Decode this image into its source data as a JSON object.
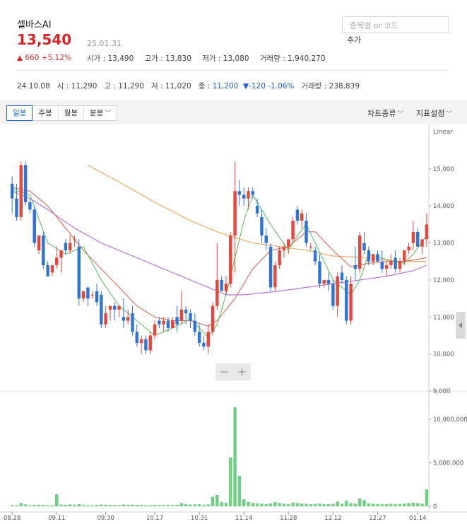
{
  "header": {
    "stock_name": "셀바스AI",
    "price": "13,540",
    "date": "25.01.31",
    "change": "▲ 660 +5.12%",
    "stats": {
      "open": "시가 : 13,490",
      "high": "고가 : 13,830",
      "low": "저가 : 13,080",
      "volume": "거래량 : 1,940,270"
    },
    "search_placeholder": "종목명 or 코드",
    "add_label": "추가"
  },
  "ohlc_line": {
    "date": "24.10.08",
    "open": "시 : 11,290",
    "high": "고 : 11,290",
    "low": "저 : 11,020",
    "close_label": "종 : ",
    "close": "11,200",
    "change": "▼-120 -1.06%",
    "volume": "거래량 : 238,839"
  },
  "toolbar": {
    "periods": [
      "일봉",
      "주봉",
      "월봉",
      "분봉"
    ],
    "active_period": "일봉",
    "chart_type": "차트종류",
    "indicator_settings": "지표설정"
  },
  "colors": {
    "up": "#e8453c",
    "down": "#2f73d8",
    "volume": "#6fcf84",
    "price_red": "#d7262a",
    "ma5": "#62c162",
    "ma20": "#d9695a",
    "ma60": "#b26ad8",
    "ma120": "#f0a358"
  },
  "chart_data": {
    "type": "candlestick",
    "scale": "Linear",
    "x_tick_labels": [
      "08.28",
      "09.11",
      "09.30",
      "10.17",
      "10.31",
      "11.14",
      "11.28",
      "12.12",
      "12.27",
      "01.14"
    ],
    "price_axis": {
      "ticks": [
        9000,
        10000,
        11000,
        12000,
        13000,
        14000,
        15000
      ],
      "labels": [
        "9,000",
        "10,000",
        "11,000",
        "12,000",
        "13,000",
        "14,000",
        "15,000"
      ]
    },
    "volume_axis": {
      "ticks": [
        0,
        5000000,
        10000000
      ],
      "labels": [
        "0",
        "5,000,000",
        "10,000,000"
      ]
    },
    "candles": [
      [
        14600,
        14800,
        13800,
        14200,
        150000
      ],
      [
        14200,
        14600,
        13600,
        13700,
        140000
      ],
      [
        13700,
        15200,
        13600,
        15100,
        380000
      ],
      [
        15100,
        15200,
        14000,
        14100,
        220000
      ],
      [
        14100,
        14200,
        13800,
        13900,
        120000
      ],
      [
        13900,
        14000,
        12900,
        13000,
        160000
      ],
      [
        12800,
        13200,
        12700,
        13200,
        180000
      ],
      [
        13200,
        13300,
        12300,
        12400,
        150000
      ],
      [
        12400,
        12500,
        12100,
        12100,
        120000
      ],
      [
        12200,
        12400,
        12100,
        12400,
        130000
      ],
      [
        12400,
        12900,
        12300,
        12600,
        1400000
      ],
      [
        12600,
        12800,
        12200,
        12800,
        200000
      ],
      [
        13000,
        13100,
        12700,
        12800,
        160000
      ],
      [
        12800,
        13200,
        12700,
        13000,
        220000
      ],
      [
        13100,
        13200,
        12900,
        13100,
        180000
      ],
      [
        12900,
        13100,
        11300,
        11500,
        260000
      ],
      [
        11500,
        11700,
        11400,
        11700,
        140000
      ],
      [
        11800,
        11800,
        11300,
        11500,
        120000
      ],
      [
        11600,
        11700,
        11500,
        11600,
        110000
      ],
      [
        11700,
        11900,
        11300,
        11400,
        160000
      ],
      [
        11600,
        11700,
        10700,
        10800,
        200000
      ],
      [
        10800,
        11300,
        10700,
        11100,
        180000
      ],
      [
        11200,
        11300,
        10900,
        11300,
        150000
      ],
      [
        11300,
        11400,
        10900,
        11200,
        140000
      ],
      [
        11200,
        11300,
        11000,
        11300,
        120000
      ],
      [
        11000,
        11500,
        10700,
        10900,
        210000
      ],
      [
        10900,
        11200,
        10800,
        11000,
        170000
      ],
      [
        11100,
        11300,
        10500,
        10600,
        190000
      ],
      [
        10600,
        10800,
        10200,
        10300,
        160000
      ],
      [
        10300,
        10500,
        10000,
        10400,
        140000
      ],
      [
        10400,
        10500,
        10000,
        10100,
        130000
      ],
      [
        10100,
        10600,
        10000,
        10500,
        120000
      ],
      [
        10500,
        10900,
        10400,
        10800,
        150000
      ],
      [
        10900,
        11000,
        10700,
        10800,
        140000
      ],
      [
        10800,
        11000,
        10600,
        10900,
        130000
      ],
      [
        10900,
        11000,
        10600,
        10700,
        160000
      ],
      [
        10700,
        11000,
        10700,
        10900,
        140000
      ],
      [
        11000,
        11300,
        10600,
        10800,
        180000
      ],
      [
        10900,
        11700,
        10800,
        11200,
        380000
      ],
      [
        11200,
        11300,
        10800,
        11100,
        260000
      ],
      [
        11100,
        11200,
        10700,
        10900,
        200000
      ],
      [
        10900,
        11100,
        10500,
        10600,
        220000
      ],
      [
        10600,
        10800,
        10200,
        10300,
        240000
      ],
      [
        10300,
        10500,
        10100,
        10200,
        180000
      ],
      [
        10200,
        10800,
        10000,
        10600,
        210000
      ],
      [
        10600,
        11400,
        10500,
        11300,
        1100000
      ],
      [
        11300,
        13000,
        11200,
        12000,
        1300000
      ],
      [
        12000,
        12100,
        11700,
        11700,
        500000
      ],
      [
        11700,
        12100,
        11600,
        11900,
        400000
      ],
      [
        11900,
        13300,
        11800,
        13200,
        5600000
      ],
      [
        13200,
        15200,
        12200,
        14400,
        11400000
      ],
      [
        14400,
        14700,
        14000,
        14300,
        3500000
      ],
      [
        14300,
        14500,
        14000,
        14200,
        800000
      ],
      [
        14200,
        14500,
        13900,
        14400,
        500000
      ],
      [
        14400,
        14500,
        14200,
        14300,
        400000
      ],
      [
        14000,
        14200,
        13700,
        13800,
        350000
      ],
      [
        13700,
        13900,
        13000,
        13200,
        300000
      ],
      [
        13200,
        13400,
        12800,
        13000,
        260000
      ],
      [
        12900,
        13000,
        11700,
        11800,
        320000
      ],
      [
        11800,
        12500,
        11700,
        12400,
        500000
      ],
      [
        12400,
        12900,
        12300,
        12800,
        380000
      ],
      [
        12800,
        13000,
        12600,
        12900,
        300000
      ],
      [
        12900,
        13100,
        12700,
        13100,
        250000
      ],
      [
        13100,
        13700,
        13000,
        13600,
        420000
      ],
      [
        13900,
        14000,
        13500,
        13600,
        380000
      ],
      [
        13600,
        13900,
        13400,
        13800,
        330000
      ],
      [
        13600,
        13800,
        12900,
        13000,
        300000
      ],
      [
        12900,
        13000,
        12800,
        12900,
        250000
      ],
      [
        12800,
        12900,
        12400,
        12500,
        280000
      ],
      [
        12500,
        12700,
        11800,
        11900,
        330000
      ],
      [
        11900,
        12000,
        11800,
        12000,
        260000
      ],
      [
        12000,
        12200,
        11700,
        11900,
        240000
      ],
      [
        11900,
        12000,
        11200,
        11300,
        300000
      ],
      [
        11300,
        12200,
        11000,
        12100,
        550000
      ],
      [
        12200,
        12400,
        11900,
        12000,
        300000
      ],
      [
        12000,
        12100,
        10800,
        10900,
        640000
      ],
      [
        10900,
        12100,
        10800,
        11900,
        380000
      ],
      [
        12400,
        12900,
        12000,
        12300,
        300000
      ],
      [
        12300,
        13300,
        12200,
        13200,
        900000
      ],
      [
        13000,
        13300,
        12700,
        12800,
        700000
      ],
      [
        12800,
        12900,
        12400,
        12500,
        350000
      ],
      [
        12500,
        12700,
        12400,
        12700,
        300000
      ],
      [
        12700,
        12800,
        12500,
        12500,
        280000
      ],
      [
        12500,
        12800,
        12200,
        12300,
        260000
      ],
      [
        12300,
        12500,
        12100,
        12400,
        250000
      ],
      [
        12400,
        12700,
        12300,
        12500,
        300000
      ],
      [
        12600,
        12800,
        12200,
        12300,
        280000
      ],
      [
        12300,
        12600,
        12200,
        12500,
        260000
      ],
      [
        12500,
        12800,
        12400,
        12800,
        320000
      ],
      [
        12800,
        13000,
        12700,
        12900,
        380000
      ],
      [
        13000,
        13600,
        12800,
        13300,
        420000
      ],
      [
        13300,
        13400,
        12900,
        12900,
        360000
      ],
      [
        12900,
        13100,
        12700,
        13100,
        300000
      ],
      [
        13100,
        13800,
        12900,
        13500,
        1940000
      ]
    ],
    "ma5": [
      [
        0,
        14450
      ],
      [
        4,
        14300
      ],
      [
        8,
        13000
      ],
      [
        12,
        12700
      ],
      [
        16,
        12900
      ],
      [
        20,
        12000
      ],
      [
        24,
        11300
      ],
      [
        28,
        10900
      ],
      [
        32,
        10500
      ],
      [
        36,
        10700
      ],
      [
        40,
        10950
      ],
      [
        44,
        10450
      ],
      [
        46,
        10800
      ],
      [
        48,
        11600
      ],
      [
        50,
        12600
      ],
      [
        52,
        13600
      ],
      [
        54,
        14300
      ],
      [
        58,
        13500
      ],
      [
        62,
        12800
      ],
      [
        64,
        13200
      ],
      [
        66,
        13500
      ],
      [
        70,
        12500
      ],
      [
        72,
        12000
      ],
      [
        76,
        11600
      ],
      [
        78,
        12000
      ],
      [
        80,
        12700
      ],
      [
        84,
        12550
      ],
      [
        88,
        12450
      ],
      [
        90,
        12700
      ],
      [
        93,
        13200
      ]
    ],
    "ma20": [
      [
        0,
        14500
      ],
      [
        4,
        14400
      ],
      [
        8,
        14000
      ],
      [
        12,
        13400
      ],
      [
        16,
        12800
      ],
      [
        20,
        12300
      ],
      [
        24,
        11800
      ],
      [
        28,
        11300
      ],
      [
        32,
        11000
      ],
      [
        36,
        10900
      ],
      [
        40,
        10900
      ],
      [
        44,
        10750
      ],
      [
        46,
        10900
      ],
      [
        50,
        11500
      ],
      [
        54,
        12300
      ],
      [
        58,
        12800
      ],
      [
        62,
        12900
      ],
      [
        66,
        13300
      ],
      [
        68,
        13300
      ],
      [
        72,
        12800
      ],
      [
        76,
        12350
      ],
      [
        80,
        12450
      ],
      [
        84,
        12500
      ],
      [
        88,
        12500
      ],
      [
        93,
        12600
      ]
    ],
    "ma60": [
      [
        0,
        14400
      ],
      [
        4,
        14200
      ],
      [
        8,
        13900
      ],
      [
        14,
        13400
      ],
      [
        20,
        13000
      ],
      [
        26,
        12700
      ],
      [
        32,
        12400
      ],
      [
        38,
        12100
      ],
      [
        44,
        11800
      ],
      [
        48,
        11600
      ],
      [
        52,
        11600
      ],
      [
        60,
        11700
      ],
      [
        66,
        11800
      ],
      [
        72,
        11900
      ],
      [
        78,
        12000
      ],
      [
        84,
        12100
      ],
      [
        90,
        12250
      ],
      [
        93,
        12400
      ]
    ],
    "ma120": [
      [
        17,
        15100
      ],
      [
        24,
        14650
      ],
      [
        32,
        14100
      ],
      [
        40,
        13600
      ],
      [
        46,
        13300
      ],
      [
        54,
        13000
      ],
      [
        60,
        12900
      ],
      [
        66,
        12800
      ],
      [
        72,
        12650
      ],
      [
        80,
        12600
      ],
      [
        86,
        12500
      ],
      [
        93,
        12500
      ]
    ]
  }
}
